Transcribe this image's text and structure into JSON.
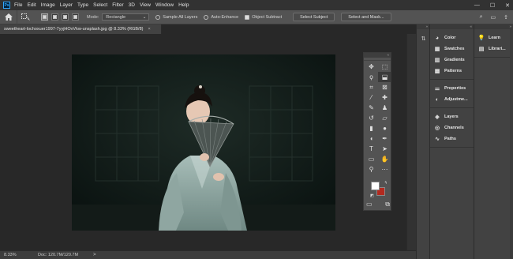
{
  "app": {
    "logo": "Ps"
  },
  "menu": [
    "File",
    "Edit",
    "Image",
    "Layer",
    "Type",
    "Select",
    "Filter",
    "3D",
    "View",
    "Window",
    "Help"
  ],
  "window_controls": {
    "minimize": "—",
    "maximize": "☐",
    "close": "✕"
  },
  "options": {
    "mode_label": "Mode:",
    "mode_value": "Rectangle",
    "sample_all_layers": "Sample All Layers",
    "auto_enhance": "Auto-Enhance",
    "object_subtract": "Object Subtract",
    "select_subject": "Select Subject",
    "select_and_mask": "Select and Mask...",
    "right_icons": [
      "⌕",
      "▭",
      "⇪"
    ]
  },
  "document": {
    "tab_title": "sweetheart-lochoxuer1997-7yyjHOvVkw-unsplash.jpg @ 8.33% (RGB/8)",
    "tab_close": "×"
  },
  "status": {
    "zoom": "8.33%",
    "doc_size": "Doc: 120.7M/120.7M",
    "arrow": ">"
  },
  "toolbox": {
    "collapse": "«",
    "tools": [
      {
        "name": "move-tool-icon",
        "glyph": "✥"
      },
      {
        "name": "marquee-tool-icon",
        "glyph": "⬚"
      },
      {
        "name": "lasso-tool-icon",
        "glyph": "ϙ"
      },
      {
        "name": "object-selection-tool-icon",
        "glyph": "⬓"
      },
      {
        "name": "crop-tool-icon",
        "glyph": "⌗"
      },
      {
        "name": "frame-tool-icon",
        "glyph": "⊠"
      },
      {
        "name": "eyedropper-tool-icon",
        "glyph": "⁄"
      },
      {
        "name": "healing-brush-tool-icon",
        "glyph": "✚"
      },
      {
        "name": "brush-tool-icon",
        "glyph": "✎"
      },
      {
        "name": "clone-stamp-tool-icon",
        "glyph": "♟"
      },
      {
        "name": "history-brush-tool-icon",
        "glyph": "↺"
      },
      {
        "name": "eraser-tool-icon",
        "glyph": "▱"
      },
      {
        "name": "gradient-tool-icon",
        "glyph": "▮"
      },
      {
        "name": "blur-tool-icon",
        "glyph": "●"
      },
      {
        "name": "dodge-tool-icon",
        "glyph": "◖"
      },
      {
        "name": "pen-tool-icon",
        "glyph": "✒"
      },
      {
        "name": "type-tool-icon",
        "glyph": "T"
      },
      {
        "name": "path-selection-tool-icon",
        "glyph": "➤"
      },
      {
        "name": "rectangle-tool-icon",
        "glyph": "▭"
      },
      {
        "name": "hand-tool-icon",
        "glyph": "✋"
      },
      {
        "name": "zoom-tool-icon",
        "glyph": "⚲"
      },
      {
        "name": "more-tools-icon",
        "glyph": "⋯"
      }
    ],
    "bottom_left_glyph": "▭",
    "bottom_right_glyph": "⧉",
    "swap_glyph": "↰",
    "reset_glyph": "◩"
  },
  "panels": {
    "strip_collapse": "»",
    "col2_collapse": "«",
    "col3_collapse": "»",
    "group1": [
      {
        "name": "color",
        "label": "Color",
        "glyph": "◕"
      },
      {
        "name": "swatches",
        "label": "Swatches",
        "glyph": "▦"
      },
      {
        "name": "gradients",
        "label": "Gradients",
        "glyph": "▥"
      },
      {
        "name": "patterns",
        "label": "Patterns",
        "glyph": "▩"
      }
    ],
    "group2": [
      {
        "name": "properties",
        "label": "Properties",
        "glyph": "⚌"
      },
      {
        "name": "adjustments",
        "label": "Adjustme...",
        "glyph": "◐"
      }
    ],
    "group3": [
      {
        "name": "layers",
        "label": "Layers",
        "glyph": "◈"
      },
      {
        "name": "channels",
        "label": "Channels",
        "glyph": "◎"
      },
      {
        "name": "paths",
        "label": "Paths",
        "glyph": "∿"
      }
    ],
    "col3": [
      {
        "name": "learn",
        "label": "Learn",
        "glyph": "💡"
      },
      {
        "name": "libraries",
        "label": "Librari...",
        "glyph": "▤"
      }
    ],
    "strip_glyph": "⇅"
  },
  "colors": {
    "foreground": "#ffffff",
    "background": "#b32a1f",
    "accent": "#31a8ff"
  }
}
